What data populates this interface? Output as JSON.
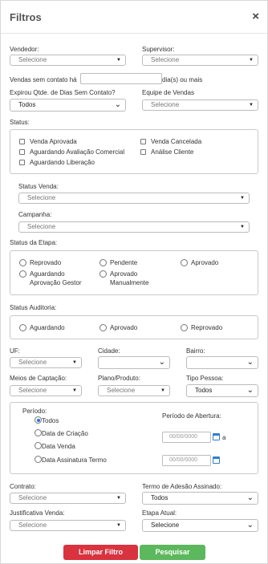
{
  "header": {
    "title": "Filtros",
    "close_label": "×"
  },
  "fields": {
    "vendedor": {
      "label": "Vendedor:",
      "value": "Selecione"
    },
    "supervisor": {
      "label": "Supervisor:",
      "value": "Selecione"
    },
    "vendas_sem_contato": {
      "label_before": "Vendas sem contato há",
      "value": "",
      "label_after": "dia(s) ou mais"
    },
    "expirou": {
      "label": "Expirou Qtde. de Dias Sem Contato?",
      "value": "Todos"
    },
    "equipe": {
      "label": "Equipe de Vendas",
      "value": "Selecione"
    },
    "status": {
      "label": "Status:",
      "options": [
        "Venda Aprovada",
        "Venda Cancelada",
        "Aguardando Avaliação Comercial",
        "Análise Cliente",
        "Aguardando Liberação"
      ]
    },
    "status_venda": {
      "label": "Status Venda:",
      "value": "Selecione"
    },
    "campanha": {
      "label": "Campanha:",
      "value": "Selecione"
    },
    "status_etapa": {
      "label": "Status da Etapa:",
      "options": [
        "Reprovado",
        "Pendente",
        "Aprovado",
        "Aguardando\nAprovação Gestor",
        "Aprovado\nManualmente"
      ]
    },
    "status_auditoria": {
      "label": "Status Auditoria:",
      "options": [
        "Aguardando",
        "Aprovado",
        "Reprovado"
      ]
    },
    "uf": {
      "label": "UF:",
      "value": "Selecione"
    },
    "cidade": {
      "label": "Cidade:",
      "value": ""
    },
    "bairro": {
      "label": "Bairro:",
      "value": ""
    },
    "meios_captacao": {
      "label": "Meios de Captação:",
      "value": "Selecione"
    },
    "plano_produto": {
      "label": "Plano/Produto:",
      "value": "Selecione"
    },
    "tipo_pessoa": {
      "label": "Tipo Pessoa:",
      "value": "Todos"
    },
    "periodo": {
      "label": "Período:",
      "options": [
        "Todos",
        "Data de Criação",
        "Data Venda",
        "Data Assinatura Termo"
      ],
      "selected": "Todos"
    },
    "periodo_abertura": {
      "label": "Período de Abertura:",
      "start_placeholder": "00/00/0000",
      "end_placeholder": "00/00/0000",
      "separator": "a"
    },
    "contrato": {
      "label": "Contrato:",
      "value": "Selecione"
    },
    "termo_adesao": {
      "label": "Termo de Adesão Assinado:",
      "value": "Todos"
    },
    "justificativa": {
      "label": "Justificativa Venda:",
      "value": "Selecione"
    },
    "etapa_atual": {
      "label": "Etapa Atual:",
      "value": "Selecione"
    }
  },
  "actions": {
    "clear_label": "Limpar Filtro",
    "search_label": "Pesquisar"
  },
  "colors": {
    "clear": "#d9333f",
    "search": "#5cb85c",
    "accent": "#1a73e8"
  },
  "icons": {
    "select_arrow": "caret-down-icon",
    "date_picker": "calendar-icon",
    "close": "close-icon"
  }
}
